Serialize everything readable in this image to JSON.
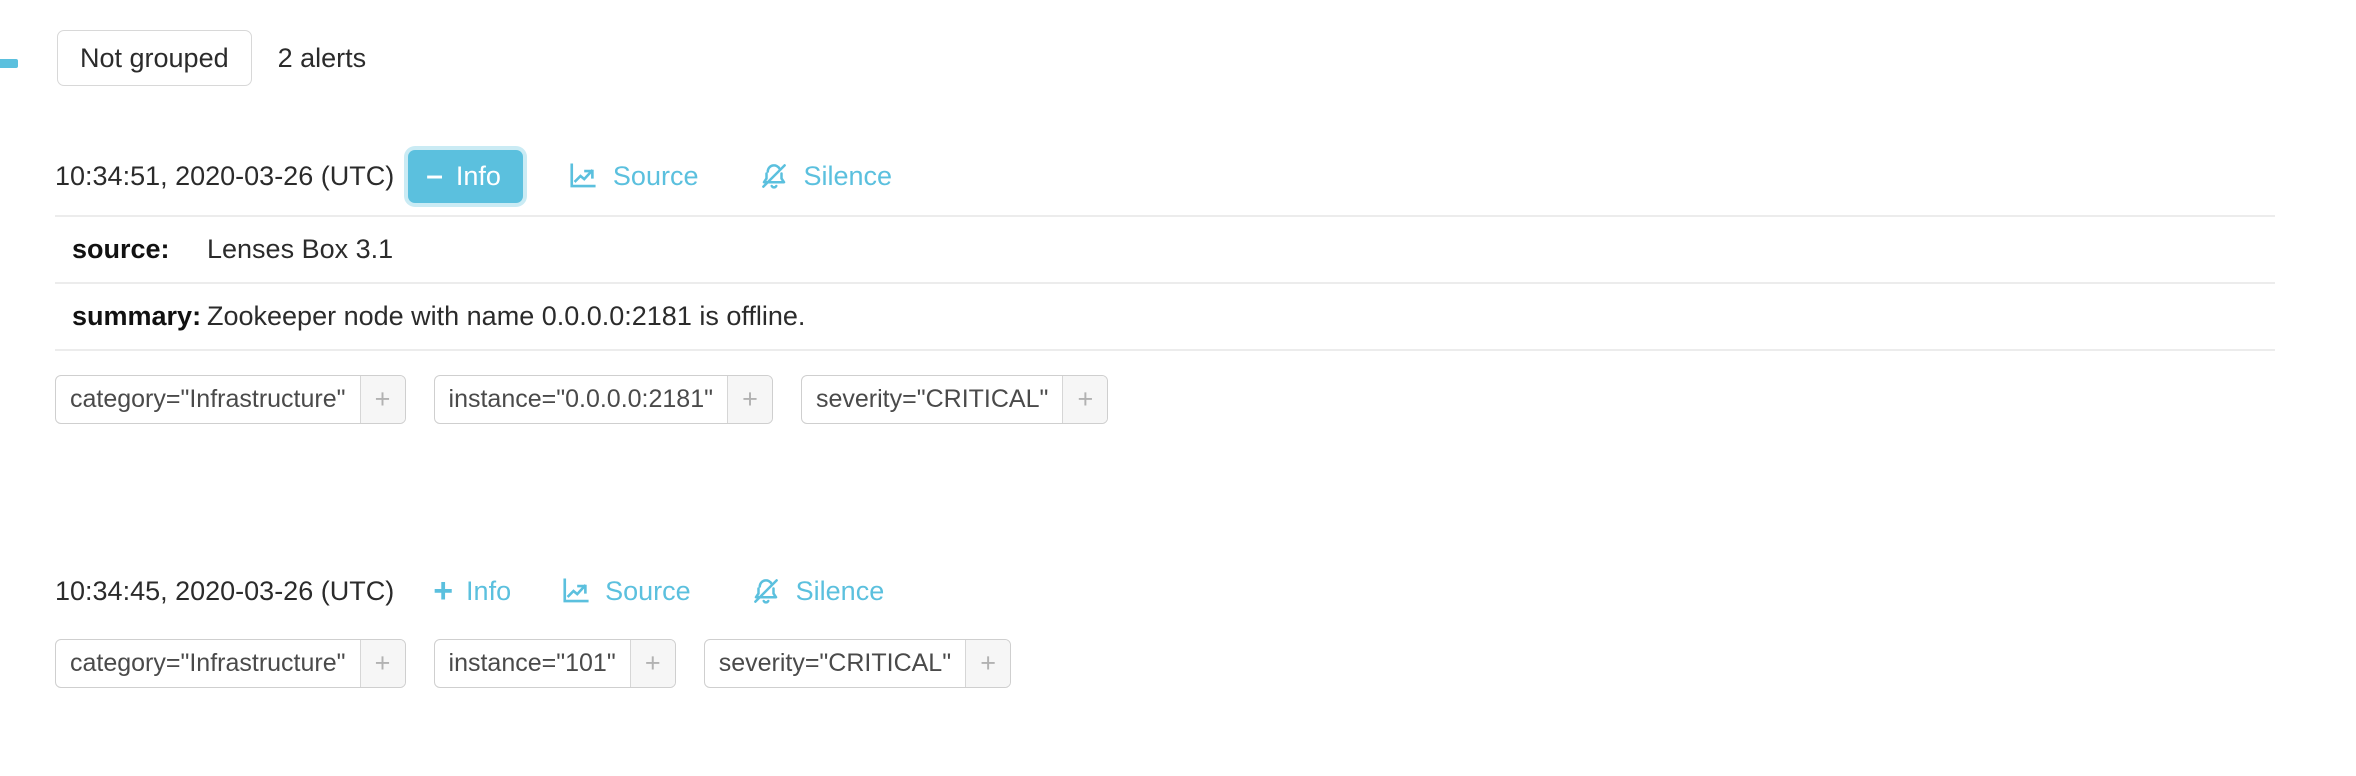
{
  "group": {
    "button_label": "Not grouped",
    "alerts_count_text": "2 alerts",
    "collapse_icon": "minus-dash-icon"
  },
  "colors": {
    "accent": "#5bc0de",
    "text": "#2b2b2b",
    "chip_border": "#cfcfcf",
    "divider": "#ececec"
  },
  "actions": {
    "info_label": "Info",
    "source_label": "Source",
    "silence_label": "Silence",
    "info_expanded_glyph": "–",
    "info_collapsed_glyph": "+",
    "chip_add_glyph": "+"
  },
  "alerts": [
    {
      "timestamp": "10:34:51, 2020-03-26 (UTC)",
      "info_expanded": true,
      "details": [
        {
          "key": "source:",
          "value": "Lenses Box 3.1"
        },
        {
          "key": "summary:",
          "value": "Zookeeper node with name 0.0.0.0:2181 is offline."
        }
      ],
      "labels": [
        "category=\"Infrastructure\"",
        "instance=\"0.0.0.0:2181\"",
        "severity=\"CRITICAL\""
      ]
    },
    {
      "timestamp": "10:34:45, 2020-03-26 (UTC)",
      "info_expanded": false,
      "details": [],
      "labels": [
        "category=\"Infrastructure\"",
        "instance=\"101\"",
        "severity=\"CRITICAL\""
      ]
    }
  ]
}
